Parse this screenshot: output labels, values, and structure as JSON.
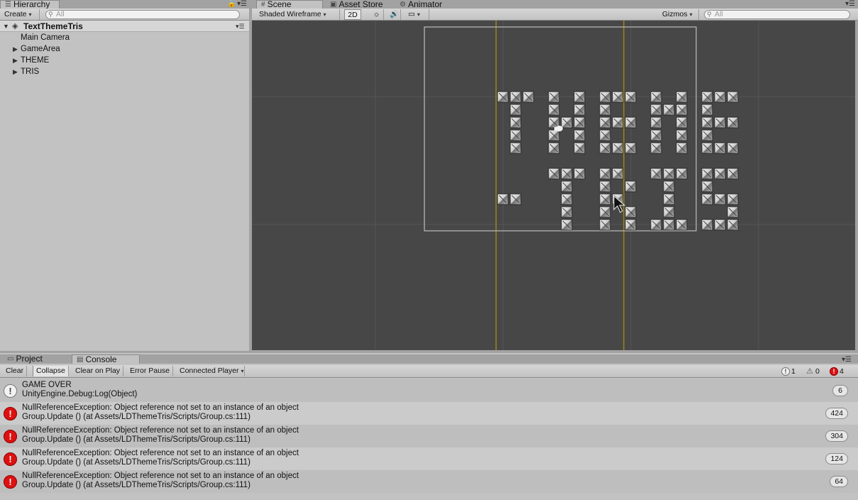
{
  "hierarchy": {
    "tab_label": "Hierarchy",
    "create_label": "Create",
    "search_placeholder": "All",
    "scene_name": "TextThemeTris",
    "items": [
      {
        "label": "Main Camera",
        "expandable": false
      },
      {
        "label": "GameArea",
        "expandable": true
      },
      {
        "label": "THEME",
        "expandable": true
      },
      {
        "label": "TRIS",
        "expandable": true
      }
    ]
  },
  "scene": {
    "tabs": [
      {
        "label": "Scene",
        "icon": "grid-icon"
      },
      {
        "label": "Asset Store",
        "icon": "store-icon"
      },
      {
        "label": "Animator",
        "icon": "animator-icon"
      }
    ],
    "draw_mode": "Shaded Wireframe",
    "mode_2d": "2D",
    "gizmos_label": "Gizmos",
    "search_placeholder": "All"
  },
  "bottom": {
    "tabs": [
      {
        "label": "Project",
        "icon": "folder-icon"
      },
      {
        "label": "Console",
        "icon": "console-icon"
      }
    ],
    "buttons": {
      "clear": "Clear",
      "collapse": "Collapse",
      "clear_on_play": "Clear on Play",
      "error_pause": "Error Pause",
      "connected_player": "Connected Player"
    },
    "counts": {
      "info": "1",
      "warnings": "0",
      "errors": "4"
    },
    "messages": [
      {
        "type": "info",
        "line1": "GAME OVER",
        "line2": "UnityEngine.Debug:Log(Object)",
        "count": "6"
      },
      {
        "type": "error",
        "line1": "NullReferenceException: Object reference not set to an instance of an object",
        "line2": "Group.Update () (at Assets/LDThemeTris/Scripts/Group.cs:111)",
        "count": "424"
      },
      {
        "type": "error",
        "line1": "NullReferenceException: Object reference not set to an instance of an object",
        "line2": "Group.Update () (at Assets/LDThemeTris/Scripts/Group.cs:111)",
        "count": "304"
      },
      {
        "type": "error",
        "line1": "NullReferenceException: Object reference not set to an instance of an object",
        "line2": "Group.Update () (at Assets/LDThemeTris/Scripts/Group.cs:111)",
        "count": "124"
      },
      {
        "type": "error",
        "line1": "NullReferenceException: Object reference not set to an instance of an object",
        "line2": "Group.Update () (at Assets/LDThemeTris/Scripts/Group.cs:111)",
        "count": "64"
      }
    ]
  },
  "colors": {
    "scene_bg": "#474747",
    "panel_bg": "#c2c2c2",
    "error_red": "#dd1111",
    "yellow_line": "#c8a000"
  }
}
